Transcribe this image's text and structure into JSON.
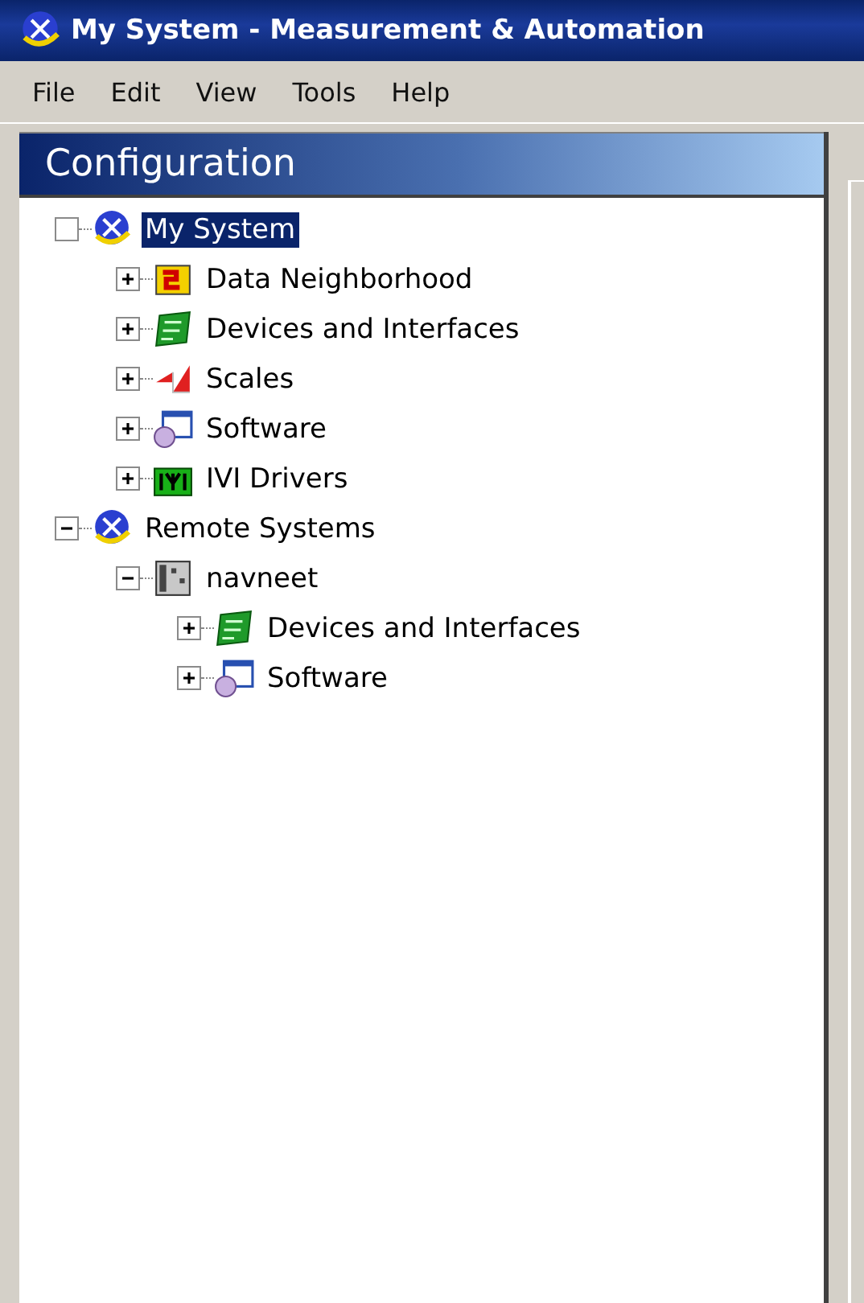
{
  "window": {
    "title": "My System - Measurement & Automation"
  },
  "menu": [
    "File",
    "Edit",
    "View",
    "Tools",
    "Help"
  ],
  "panel": {
    "title": "Configuration"
  },
  "tree": [
    {
      "label": "My System",
      "kind": "globe",
      "expanded": true,
      "sign_hidden": true,
      "selected": true,
      "children": [
        {
          "label": "Data Neighborhood",
          "kind": "folder",
          "expanded": false,
          "selected": false
        },
        {
          "label": "Devices and Interfaces",
          "kind": "card",
          "expanded": false,
          "selected": false
        },
        {
          "label": "Scales",
          "kind": "scales",
          "expanded": false,
          "selected": false
        },
        {
          "label": "Software",
          "kind": "software",
          "expanded": false,
          "selected": false
        },
        {
          "label": "IVI Drivers",
          "kind": "ivi",
          "expanded": false,
          "selected": false
        }
      ]
    },
    {
      "label": "Remote Systems",
      "kind": "globe",
      "expanded": true,
      "selected": false,
      "children": [
        {
          "label": "navneet",
          "kind": "chassis",
          "expanded": true,
          "selected": false,
          "children": [
            {
              "label": "Devices and Interfaces",
              "kind": "card",
              "expanded": false,
              "selected": false
            },
            {
              "label": "Software",
              "kind": "software",
              "expanded": false,
              "selected": false
            }
          ]
        }
      ]
    }
  ]
}
